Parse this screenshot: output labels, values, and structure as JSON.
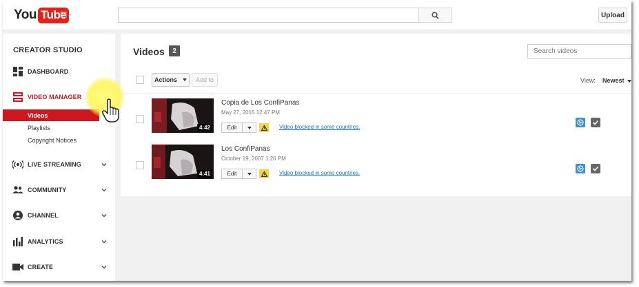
{
  "masthead": {
    "logo_you": "You",
    "logo_tube": "Tube",
    "search_value": "",
    "upload_label": "Upload"
  },
  "sidebar": {
    "title": "CREATOR STUDIO",
    "items": [
      {
        "label": "DASHBOARD",
        "icon": "dashboard-icon",
        "active": false
      },
      {
        "label": "VIDEO MANAGER",
        "icon": "video-manager-icon",
        "active": true
      },
      {
        "label": "LIVE STREAMING",
        "icon": "live-streaming-icon",
        "active": false
      },
      {
        "label": "COMMUNITY",
        "icon": "community-icon",
        "active": false
      },
      {
        "label": "CHANNEL",
        "icon": "channel-icon",
        "active": false
      },
      {
        "label": "ANALYTICS",
        "icon": "analytics-icon",
        "active": false
      },
      {
        "label": "CREATE",
        "icon": "create-icon",
        "active": false
      }
    ],
    "sub_items": [
      {
        "label": "Videos",
        "active": true
      },
      {
        "label": "Playlists",
        "active": false
      },
      {
        "label": "Copyright Notices",
        "active": false
      }
    ]
  },
  "main": {
    "title": "Videos",
    "count": "2",
    "search_placeholder": "Search videos",
    "actions_label": "Actions",
    "add_to_label": "Add to",
    "view_label": "View:",
    "view_value": "Newest",
    "edit_label": "Edit",
    "videos": [
      {
        "title": "Copia de Los ConfiPanas",
        "date": "May 27, 2015 12:47 PM",
        "duration": "4:42",
        "notice": "Video blocked in some countries."
      },
      {
        "title": "Los ConfiPanas",
        "date": "October 19, 2007 1:26 PM",
        "duration": "4:41",
        "notice": "Video blocked in some countries."
      }
    ]
  },
  "colors": {
    "brand_red": "#cc181e",
    "link_blue": "#167ac6",
    "warning_yellow": "#f6d547",
    "public_blue": "#3a8de0"
  }
}
